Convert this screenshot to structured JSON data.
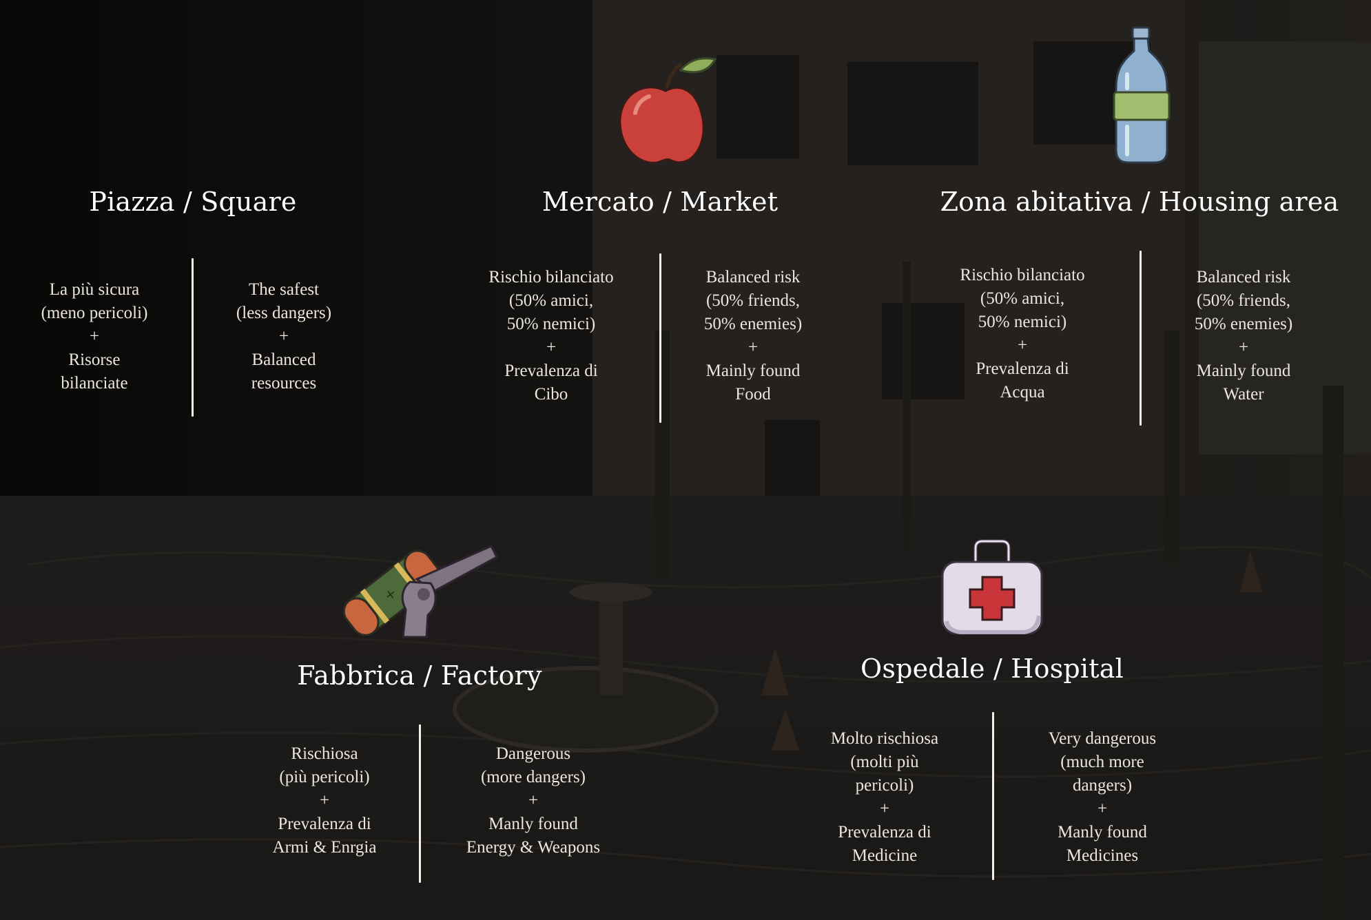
{
  "zones": {
    "square": {
      "title": "Piazza / Square",
      "it": [
        "La più sicura",
        "(meno pericoli)",
        "+",
        "Risorse",
        "bilanciate"
      ],
      "en": [
        "The safest",
        "(less dangers)",
        "+",
        "Balanced",
        "resources"
      ]
    },
    "market": {
      "title": "Mercato / Market",
      "icon": "apple-icon",
      "it": [
        "Rischio bilanciato",
        "(50% amici,",
        "50% nemici)",
        "+",
        "Prevalenza di",
        "Cibo"
      ],
      "en": [
        "Balanced risk",
        "(50% friends,",
        "50% enemies)",
        "+",
        "Mainly found",
        "Food"
      ]
    },
    "housing": {
      "title": "Zona abitativa / Housing area",
      "icon": "water-bottle-icon",
      "it": [
        "Rischio bilanciato",
        "(50% amici,",
        "50% nemici)",
        "+",
        "Prevalenza di",
        "Acqua"
      ],
      "en": [
        "Balanced risk",
        "(50% friends,",
        "50% enemies)",
        "+",
        "Mainly found",
        "Water"
      ]
    },
    "factory": {
      "title": "Fabbrica / Factory",
      "icon": "battery-and-gun-icon",
      "it": [
        "Rischiosa",
        "(più pericoli)",
        "+",
        "Prevalenza di",
        "Armi & Enrgia"
      ],
      "en": [
        "Dangerous",
        "(more dangers)",
        "+",
        "Manly found",
        "Energy & Weapons"
      ]
    },
    "hospital": {
      "title": "Ospedale / Hospital",
      "icon": "first-aid-kit-icon",
      "it": [
        "Molto rischiosa",
        "(molti più",
        "pericoli)",
        "+",
        "Prevalenza di",
        "Medicine"
      ],
      "en": [
        "Very dangerous",
        "(much more",
        "dangers)",
        "+",
        "Manly found",
        "Medicines"
      ]
    }
  },
  "colors": {
    "text": "#ffffff",
    "divider": "#f4f1ea",
    "apple": "#c9413a",
    "bottle": "#8fb0cf",
    "label": "#9fbf6e",
    "kit_cross": "#c8363a"
  }
}
